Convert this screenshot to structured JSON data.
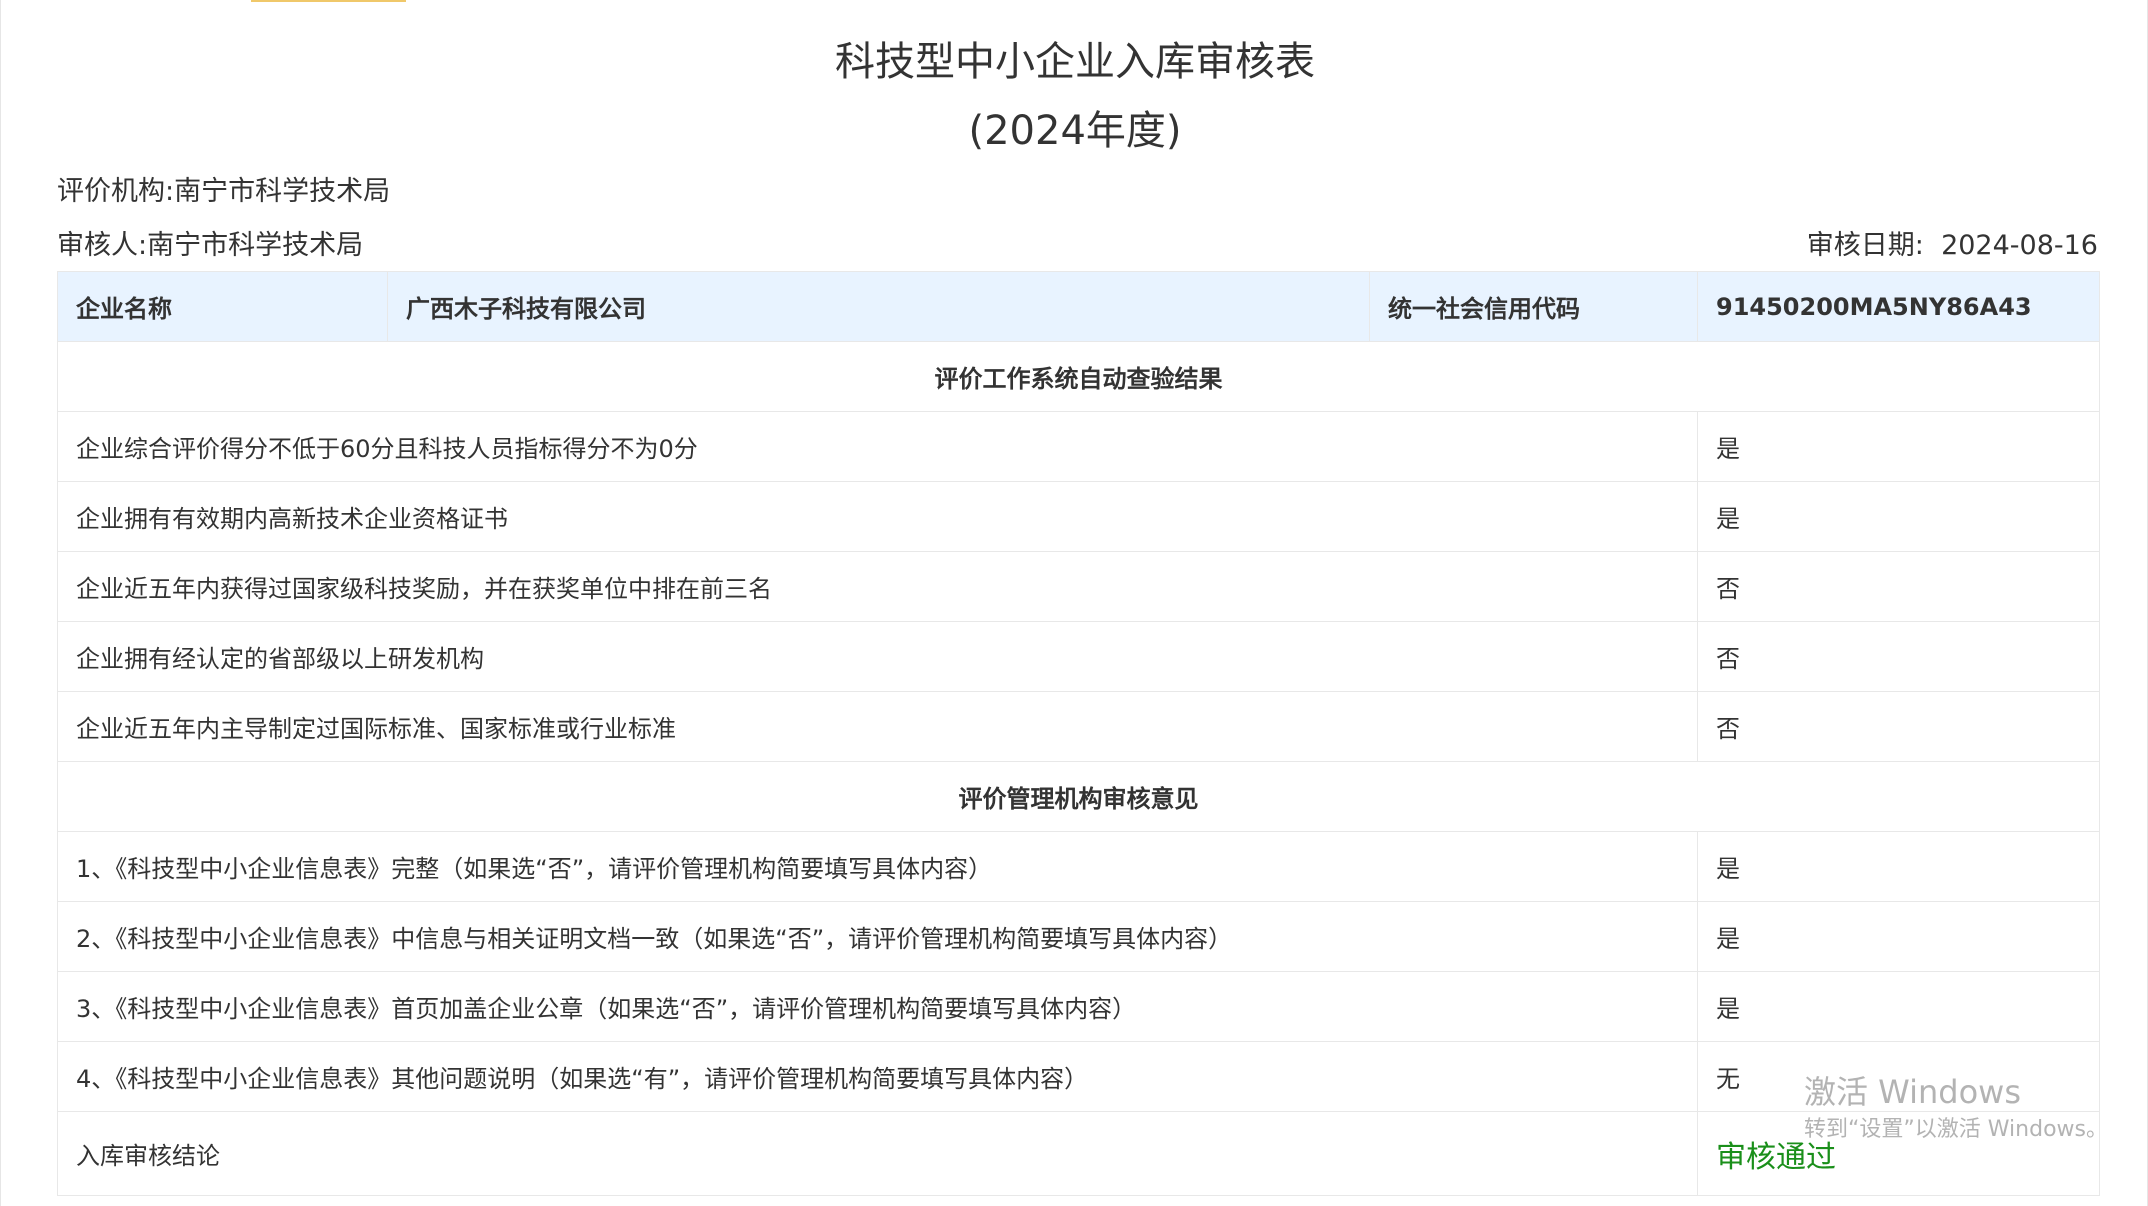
{
  "page": {
    "title": "科技型中小企业入库审核表",
    "subtitle": "(2024年度)"
  },
  "meta": {
    "org_label": "评价机构:",
    "org_value": "南宁市科学技术局",
    "reviewer_label": "审核人:",
    "reviewer_value": "南宁市科学技术局",
    "date_label": "审核日期:",
    "date_value": "2024-08-16"
  },
  "header": {
    "company_label": "企业名称",
    "company_value": "广西木子科技有限公司",
    "credit_label": "统一社会信用代码",
    "credit_value": "91450200MA5NY86A43"
  },
  "auto_check": {
    "section_title": "评价工作系统自动查验结果",
    "rows": [
      {
        "item": "企业综合评价得分不低于60分且科技人员指标得分不为0分",
        "result": "是"
      },
      {
        "item": "企业拥有有效期内高新技术企业资格证书",
        "result": "是"
      },
      {
        "item": "企业近五年内获得过国家级科技奖励，并在获奖单位中排在前三名",
        "result": "否"
      },
      {
        "item": "企业拥有经认定的省部级以上研发机构",
        "result": "否"
      },
      {
        "item": "企业近五年内主导制定过国际标准、国家标准或行业标准",
        "result": "否"
      }
    ]
  },
  "review": {
    "section_title": "评价管理机构审核意见",
    "rows": [
      {
        "item": "1、《科技型中小企业信息表》完整（如果选“否”，请评价管理机构简要填写具体内容）",
        "result": "是"
      },
      {
        "item": "2、《科技型中小企业信息表》中信息与相关证明文档一致（如果选“否”，请评价管理机构简要填写具体内容）",
        "result": "是"
      },
      {
        "item": "3、《科技型中小企业信息表》首页加盖企业公章（如果选“否”，请评价管理机构简要填写具体内容）",
        "result": "是"
      },
      {
        "item": "4、《科技型中小企业信息表》其他问题说明（如果选“有”，请评价管理机构简要填写具体内容）",
        "result": "无"
      }
    ]
  },
  "conclusion": {
    "label": "入库审核结论",
    "value": "审核通过",
    "value_color": "#1a8f1a"
  },
  "watermark": {
    "line1": "激活 Windows",
    "line2": "转到“设置”以激活 Windows。"
  },
  "colors": {
    "header_bg": "#e8f3ff",
    "border": "#e8e8e8",
    "accent_bar": "#f0c86a"
  }
}
